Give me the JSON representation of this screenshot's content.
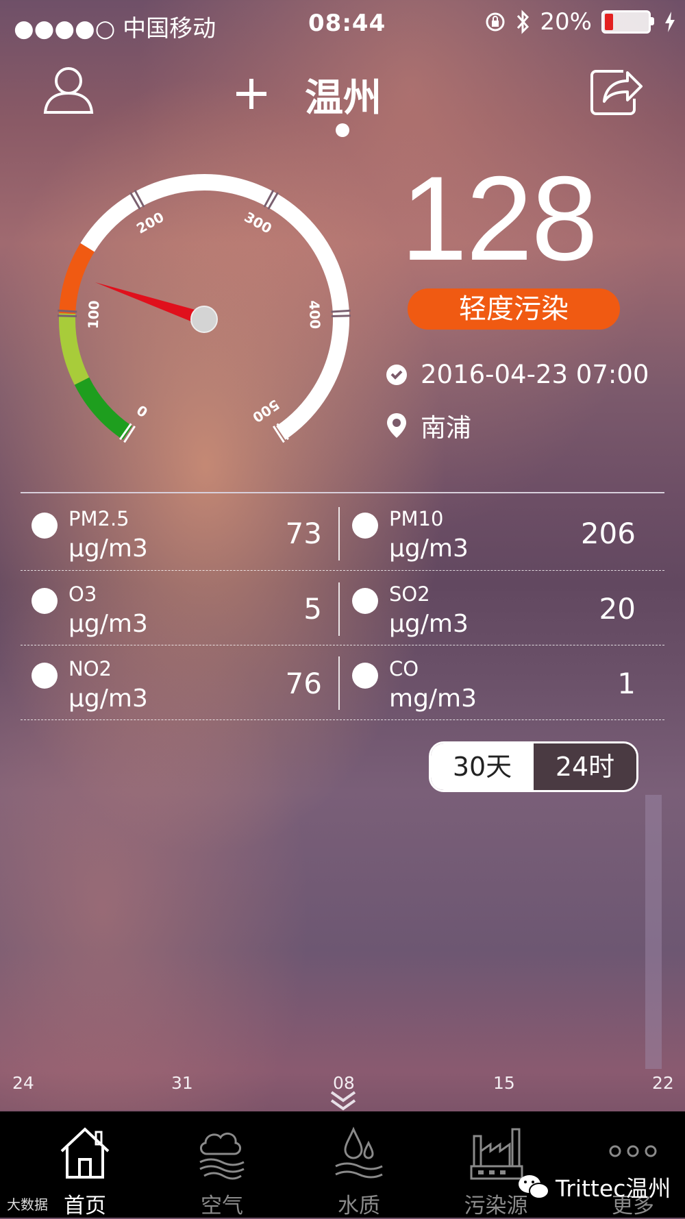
{
  "status_bar": {
    "carrier": "●●●●○ 中国移动",
    "time": "08:44",
    "battery": "20%"
  },
  "header": {
    "city": "温州",
    "add_icon": "plus-icon",
    "user_icon": "user-icon",
    "share_icon": "share-icon"
  },
  "gauge": {
    "tick_labels": [
      "0",
      "100",
      "200",
      "300",
      "400",
      "500"
    ],
    "value": 128,
    "colors": {
      "good": "#1e9e1e",
      "moderate": "#a8cc3a",
      "light": "#f05a12",
      "needle": "#e0101c"
    }
  },
  "aqi": {
    "value": "128",
    "level": "轻度污染",
    "timestamp": "2016-04-23 07:00",
    "station": "南浦"
  },
  "pollutants": [
    {
      "name": "PM2.5",
      "unit": "µg/m3",
      "value": "73"
    },
    {
      "name": "PM10",
      "unit": "µg/m3",
      "value": "206"
    },
    {
      "name": "O3",
      "unit": "µg/m3",
      "value": "5"
    },
    {
      "name": "SO2",
      "unit": "µg/m3",
      "value": "20"
    },
    {
      "name": "NO2",
      "unit": "µg/m3",
      "value": "76"
    },
    {
      "name": "CO",
      "unit": "mg/m3",
      "value": "1"
    }
  ],
  "toggle": {
    "option_30d": "30天",
    "option_24h": "24时",
    "selected": "30天"
  },
  "chart_axis": {
    "x_labels": [
      "24",
      "31",
      "08",
      "15",
      "22"
    ]
  },
  "tabbar": {
    "items": [
      {
        "label": "首页",
        "icon": "home-icon",
        "active": true
      },
      {
        "label": "空气",
        "icon": "air-icon",
        "active": false
      },
      {
        "label": "水质",
        "icon": "water-icon",
        "active": false
      },
      {
        "label": "污染源",
        "icon": "factory-icon",
        "active": false
      },
      {
        "label": "更多",
        "icon": "more-icon",
        "active": false
      }
    ]
  },
  "watermarks": {
    "wechat": "Trittec温州",
    "corner": "大数据"
  }
}
